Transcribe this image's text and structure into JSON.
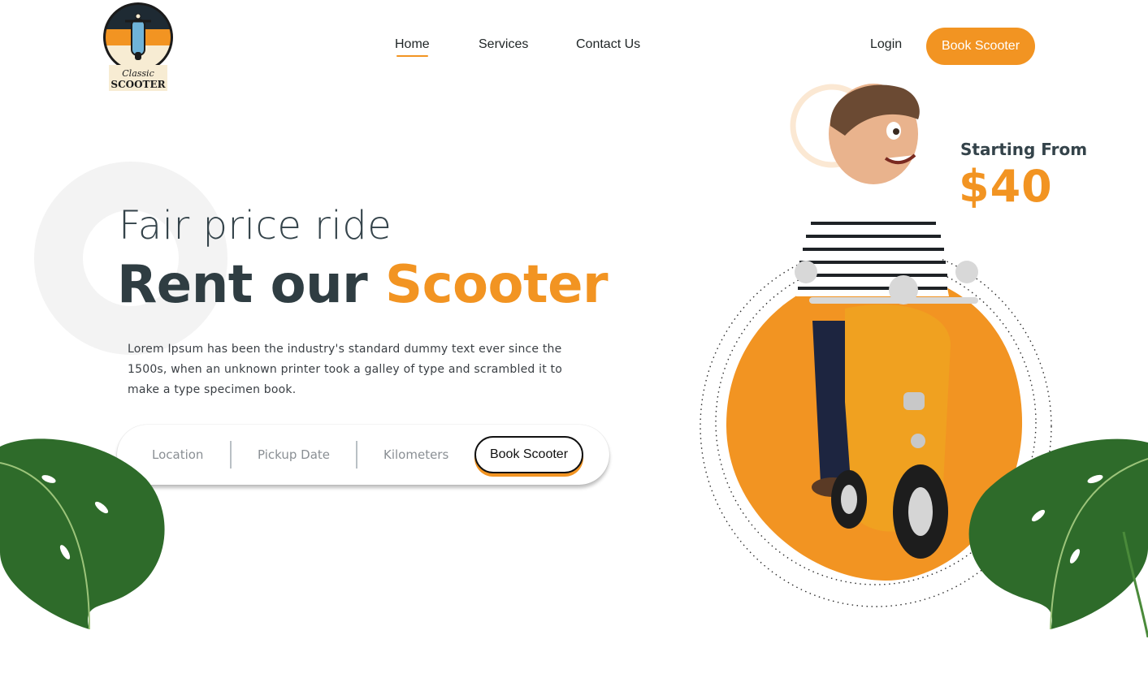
{
  "logo": {
    "line1": "Classic",
    "line2": "SCOOTER"
  },
  "nav": {
    "home": "Home",
    "services": "Services",
    "contact": "Contact Us",
    "login": "Login",
    "book_button": "Book Scooter"
  },
  "hero": {
    "tagline": "Fair price ride",
    "headline_plain": "Rent our ",
    "headline_accent": "Scooter",
    "description": "Lorem Ipsum has been the industry's standard dummy text ever since the 1500s, when an unknown printer took a galley of type and scrambled it to make a type specimen book."
  },
  "search": {
    "location_placeholder": "Location",
    "pickup_placeholder": "Pickup Date",
    "kilometers_placeholder": "Kilometers",
    "book_button": "Book Scooter"
  },
  "pricing": {
    "label": "Starting From",
    "value": "$40"
  },
  "colors": {
    "accent": "#f29422",
    "dark_text": "#2f3d42"
  }
}
